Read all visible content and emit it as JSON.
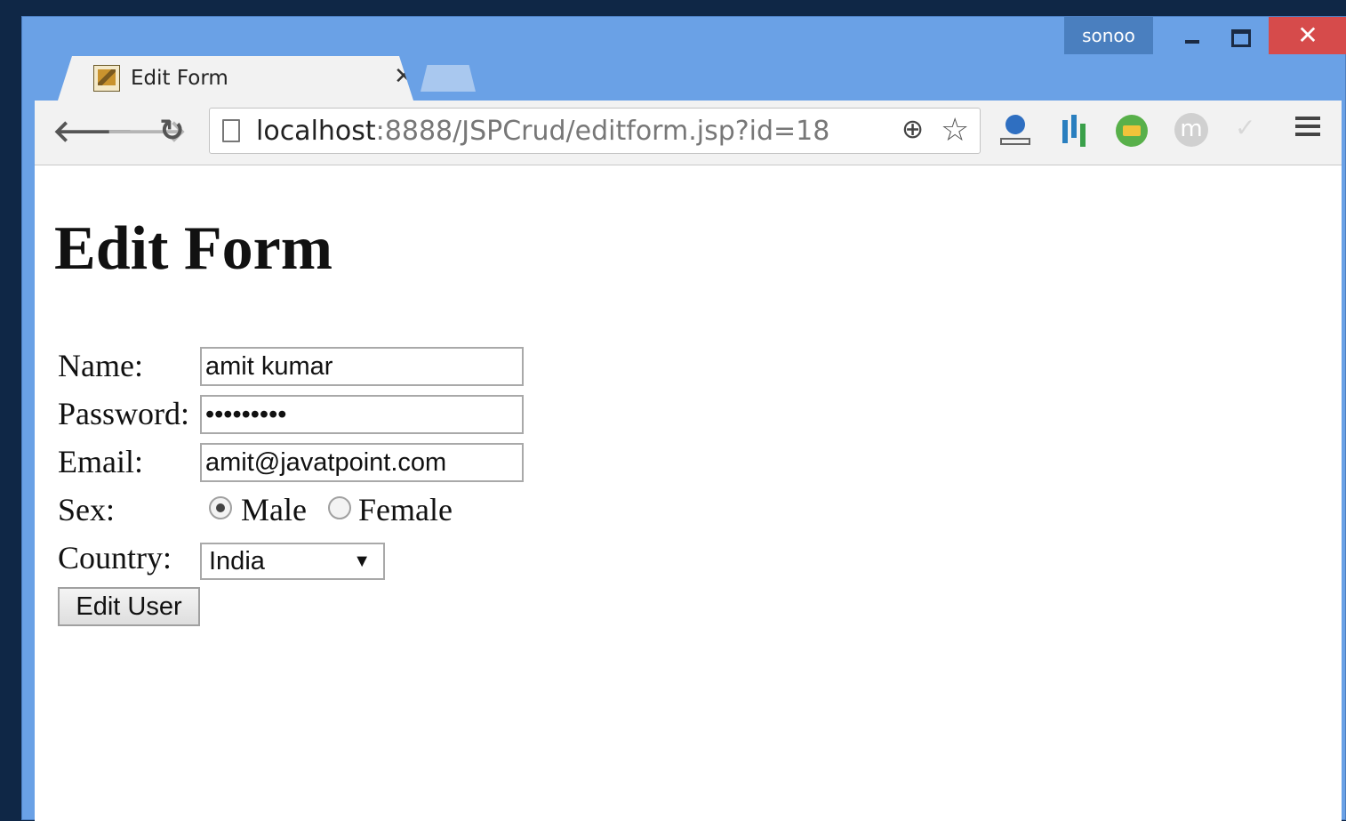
{
  "window": {
    "profile": "sonoo",
    "close_glyph": "✕"
  },
  "tab": {
    "title": "Edit Form",
    "close_glyph": "✕"
  },
  "toolbar": {
    "url_host": "localhost",
    "url_rest": ":8888/JSPCrud/editform.jsp?id=18",
    "back_glyph": "🡐",
    "forward_glyph": "🡒",
    "reload_glyph": "↻",
    "zoom_glyph": "⊕",
    "star_glyph": "☆"
  },
  "page": {
    "heading": "Edit Form",
    "labels": {
      "name": "Name:",
      "password": "Password:",
      "email": "Email:",
      "sex": "Sex:",
      "country": "Country:"
    },
    "values": {
      "name": "amit kumar",
      "password": "•••••••••",
      "email": "amit@javatpoint.com",
      "country": "India"
    },
    "sex_options": [
      "Male",
      "Female"
    ],
    "sex_selected": "Male",
    "submit_label": "Edit User"
  },
  "icons": [
    "back-icon",
    "forward-icon",
    "reload-icon",
    "page-icon",
    "zoom-icon",
    "star-icon",
    "menu-icon"
  ]
}
